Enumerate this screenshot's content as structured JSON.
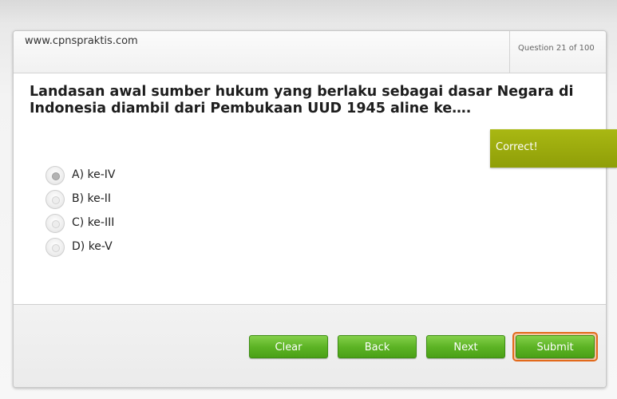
{
  "header": {
    "site": "www.cpnspraktis.com",
    "counter": "Question 21 of 100"
  },
  "question": {
    "text": "Landasan awal sumber hukum yang berlaku sebagai dasar Negara di Indonesia diambil dari Pembukaan UUD 1945 aline ke…."
  },
  "feedback": {
    "label": "Correct!"
  },
  "options": [
    {
      "label": "A)  ke-IV",
      "selected": true
    },
    {
      "label": "B)  ke-II",
      "selected": false
    },
    {
      "label": "C)  ke-III",
      "selected": false
    },
    {
      "label": "D)  ke-V",
      "selected": false
    }
  ],
  "buttons": {
    "clear": "Clear",
    "back": "Back",
    "next": "Next",
    "submit": "Submit"
  },
  "colors": {
    "button_green": "#5db425",
    "feedback_olive": "#9aaa0d",
    "submit_focus_orange": "#e26a1c"
  }
}
